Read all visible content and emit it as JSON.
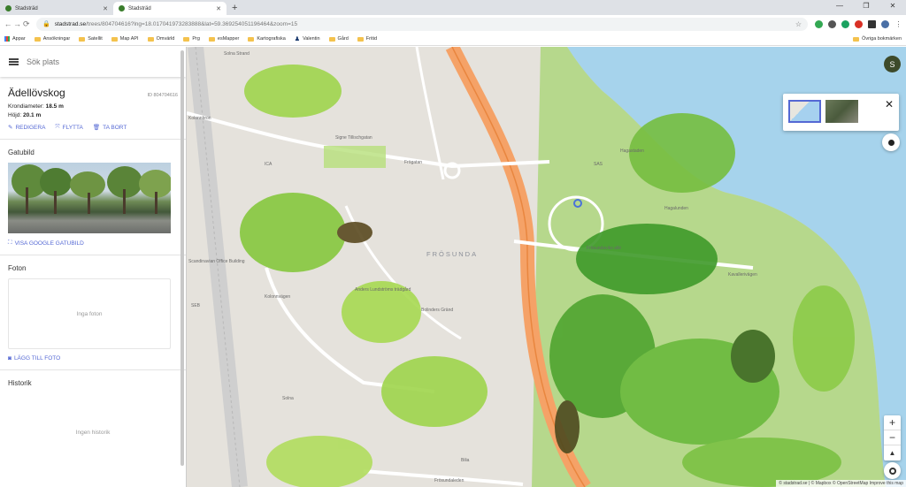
{
  "browser": {
    "tabs": [
      {
        "title": "Stadsträd",
        "active": false
      },
      {
        "title": "Stadsträd",
        "active": true
      }
    ],
    "url_host": "stadstrad.se",
    "url_path": "/trees/804704616?lng=18.017041973283888&lat=59.369254051196464&zoom=15",
    "bookmarks": [
      "Appar",
      "Ansökningar",
      "Satellit",
      "Map API",
      "Omvärld",
      "Prg",
      "esMapper",
      "Kartografiska",
      "Valentin",
      "Gård",
      "Fritid"
    ],
    "bookmarks_other": "Övriga bokmärken"
  },
  "panel": {
    "search_placeholder": "Sök plats",
    "tree": {
      "name": "Ädellövskog",
      "id": "ID 804704616",
      "crown_label": "Krondiameter:",
      "crown_value": "18.5 m",
      "height_label": "Höjd:",
      "height_value": "20.1 m"
    },
    "actions": {
      "edit": "REDIGERA",
      "move": "FLYTTA",
      "delete": "TA BORT"
    },
    "streetview": {
      "title": "Gatubild",
      "link": "VISA GOOGLE GATUBILD"
    },
    "photos": {
      "title": "Foton",
      "empty": "Inga foton",
      "add": "LÄGG TILL FOTO"
    },
    "history": {
      "title": "Historik",
      "empty": "Ingen historik"
    }
  },
  "map": {
    "district": "FRÖSUNDA",
    "labels": [
      "Signe Tillischgatan",
      "Frögatan",
      "Solna Strand",
      "Frösundaviks allé",
      "Kolonnvägen",
      "Solna",
      "Scandinavian Office Building",
      "SEB",
      "Anders Lundströms trädgård",
      "Bolinders Gränd",
      "Frösundaleden",
      "Kavallerivägen",
      "ICA",
      "SAS",
      "Bilia",
      "Hagalunden",
      "Hagastaden",
      "Kolonnbron"
    ],
    "avatar_initial": "S",
    "attribution": "© stadstrad.se | © Mapbox © OpenStreetMap  Improve this map",
    "zoom_in": "+",
    "zoom_out": "−",
    "compass": "▲"
  }
}
